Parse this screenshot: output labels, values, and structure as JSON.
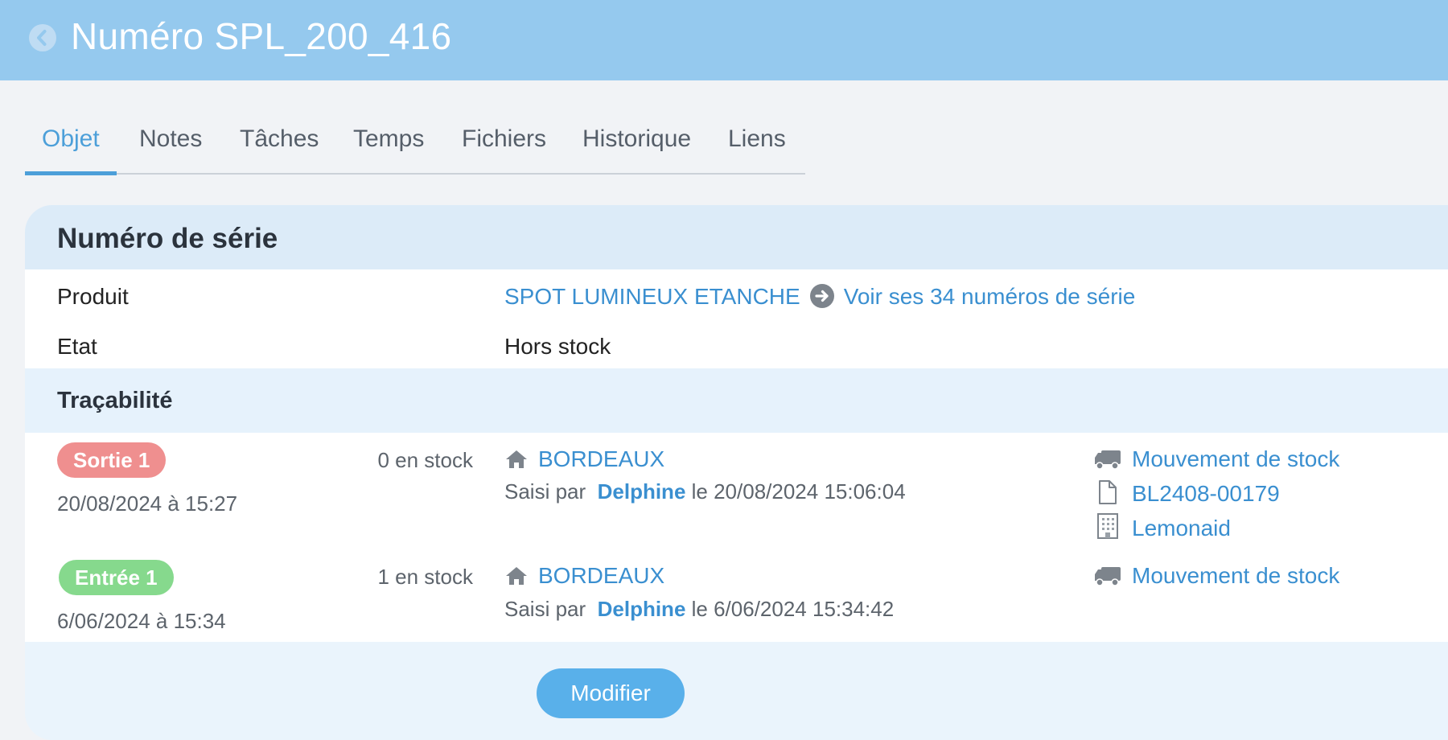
{
  "header": {
    "title": "Numéro SPL_200_416",
    "back_icon": "chevron-left-icon"
  },
  "tabs": [
    {
      "label": "Objet",
      "active": true
    },
    {
      "label": "Notes"
    },
    {
      "label": "Tâches"
    },
    {
      "label": "Temps"
    },
    {
      "label": "Fichiers"
    },
    {
      "label": "Historique"
    },
    {
      "label": "Liens"
    }
  ],
  "card": {
    "title": "Numéro de série",
    "produit": {
      "label": "Produit",
      "value": "SPOT LUMINEUX ETANCHE",
      "link": "Voir ses 34 numéros de série"
    },
    "etat": {
      "label": "Etat",
      "value": "Hors stock"
    },
    "tracabilite": {
      "title": "Traçabilité",
      "entries": [
        {
          "badge": "Sortie 1",
          "date": "20/08/2024 à 15:27",
          "stock": "0 en stock",
          "location": "BORDEAUX",
          "saisi_prefix": "Saisi par",
          "user": "Delphine",
          "saisi_suffix": "le 20/08/2024 15:06:04",
          "refs": [
            "Mouvement de stock",
            "BL2408-00179",
            "Lemonaid"
          ]
        },
        {
          "badge": "Entrée 1",
          "date": "6/06/2024 à 15:34",
          "stock": "1 en stock",
          "location": "BORDEAUX",
          "saisi_prefix": "Saisi par",
          "user": "Delphine",
          "saisi_suffix": "le 6/06/2024 15:34:42",
          "refs": [
            "Mouvement de stock"
          ]
        }
      ]
    },
    "modify_label": "Modifier"
  },
  "colors": {
    "accent": "#3a8fd0",
    "topbar": "#95c9ee",
    "badge_out": "#ef8f8f",
    "badge_in": "#86d98d"
  }
}
